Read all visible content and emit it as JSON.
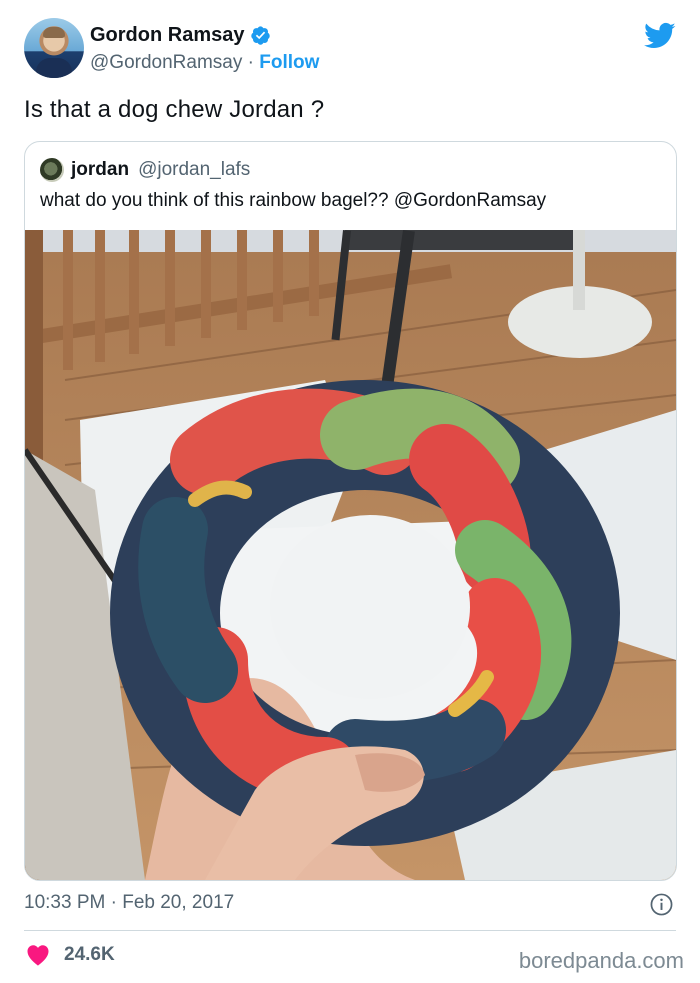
{
  "author": {
    "display_name": "Gordon Ramsay",
    "handle": "@GordonRamsay",
    "separator": "·",
    "follow_label": "Follow"
  },
  "tweet": {
    "text": "Is that a dog chew Jordan ?",
    "time": "10:33 PM",
    "date_separator": "·",
    "date": "Feb 20, 2017"
  },
  "quoted": {
    "display_name": "jordan",
    "handle": "@jordan_lafs",
    "text": "what do you think of this rainbow bagel?? @GordonRamsay"
  },
  "engagement": {
    "likes": "24.6K"
  },
  "watermark": "boredpanda.com",
  "colors": {
    "accent": "#1d9bf0",
    "heart": "#f91880",
    "muted": "#536471"
  },
  "icons": [
    "verified-badge-icon",
    "twitter-bird-icon",
    "info-icon",
    "heart-icon"
  ]
}
